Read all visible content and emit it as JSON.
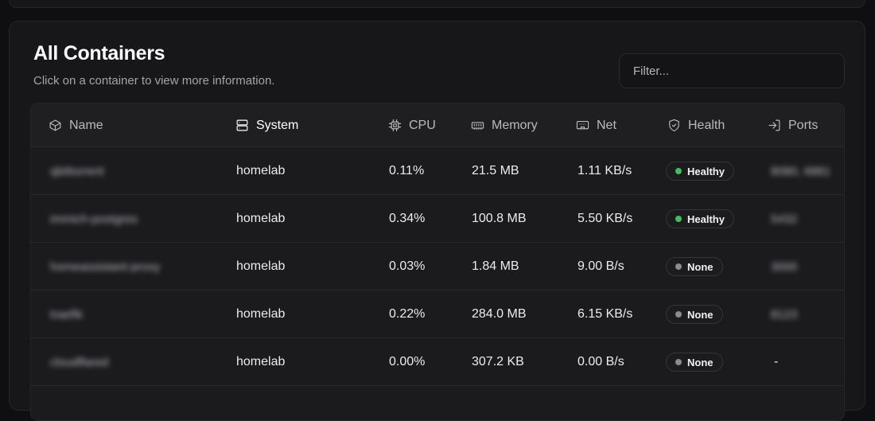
{
  "header": {
    "title": "All Containers",
    "subtitle": "Click on a container to view more information."
  },
  "filter": {
    "placeholder": "Filter...",
    "value": ""
  },
  "columns": {
    "name": "Name",
    "system": "System",
    "cpu": "CPU",
    "memory": "Memory",
    "net": "Net",
    "health": "Health",
    "ports": "Ports"
  },
  "status_colors": {
    "healthy": "#3fbf5a",
    "none": "#8a8a90"
  },
  "rows": [
    {
      "name": "qbittorrent",
      "system": "homelab",
      "cpu": "0.11%",
      "memory": "21.5 MB",
      "net": "1.11 KB/s",
      "health": "Healthy",
      "health_color": "#3fbf5a",
      "ports": "8080, 6881"
    },
    {
      "name": "immich-postgres",
      "system": "homelab",
      "cpu": "0.34%",
      "memory": "100.8 MB",
      "net": "5.50 KB/s",
      "health": "Healthy",
      "health_color": "#3fbf5a",
      "ports": "5432"
    },
    {
      "name": "homeassistant-proxy",
      "system": "homelab",
      "cpu": "0.03%",
      "memory": "1.84 MB",
      "net": "9.00 B/s",
      "health": "None",
      "health_color": "#8a8a90",
      "ports": "3000"
    },
    {
      "name": "traefik",
      "system": "homelab",
      "cpu": "0.22%",
      "memory": "284.0 MB",
      "net": "6.15 KB/s",
      "health": "None",
      "health_color": "#8a8a90",
      "ports": "8123"
    },
    {
      "name": "cloudflared",
      "system": "homelab",
      "cpu": "0.00%",
      "memory": "307.2 KB",
      "net": "0.00 B/s",
      "health": "None",
      "health_color": "#8a8a90",
      "ports": "-"
    }
  ]
}
